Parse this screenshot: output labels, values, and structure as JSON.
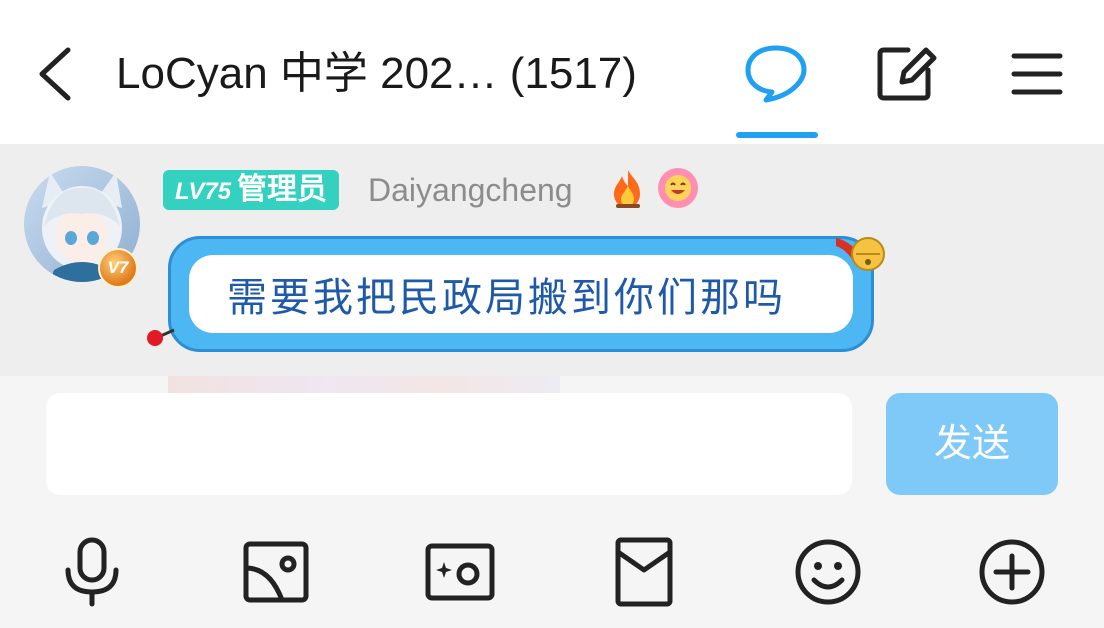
{
  "header": {
    "title": "LoCyan 中学 202… (1517)",
    "icons": [
      "back-icon",
      "chat-bubble-icon",
      "edit-icon",
      "menu-icon"
    ],
    "active_tab_color": "#1fa0f0"
  },
  "message": {
    "level": "LV75",
    "role": "管理员",
    "nickname": "Daiyangcheng",
    "vip": "V7",
    "text": "需要我把民政局搬到你们那吗",
    "bubble_color": "#4cb7f2",
    "text_color": "#1e5aa8",
    "emojis": [
      "fire-icon",
      "laughing-face-icon"
    ]
  },
  "composer": {
    "input_value": "",
    "send_label": "发送",
    "send_color": "#7ec9f8"
  },
  "toolbar": {
    "icons": [
      "microphone-icon",
      "image-icon",
      "camera-icon",
      "red-packet-icon",
      "emoji-icon",
      "plus-icon"
    ]
  }
}
